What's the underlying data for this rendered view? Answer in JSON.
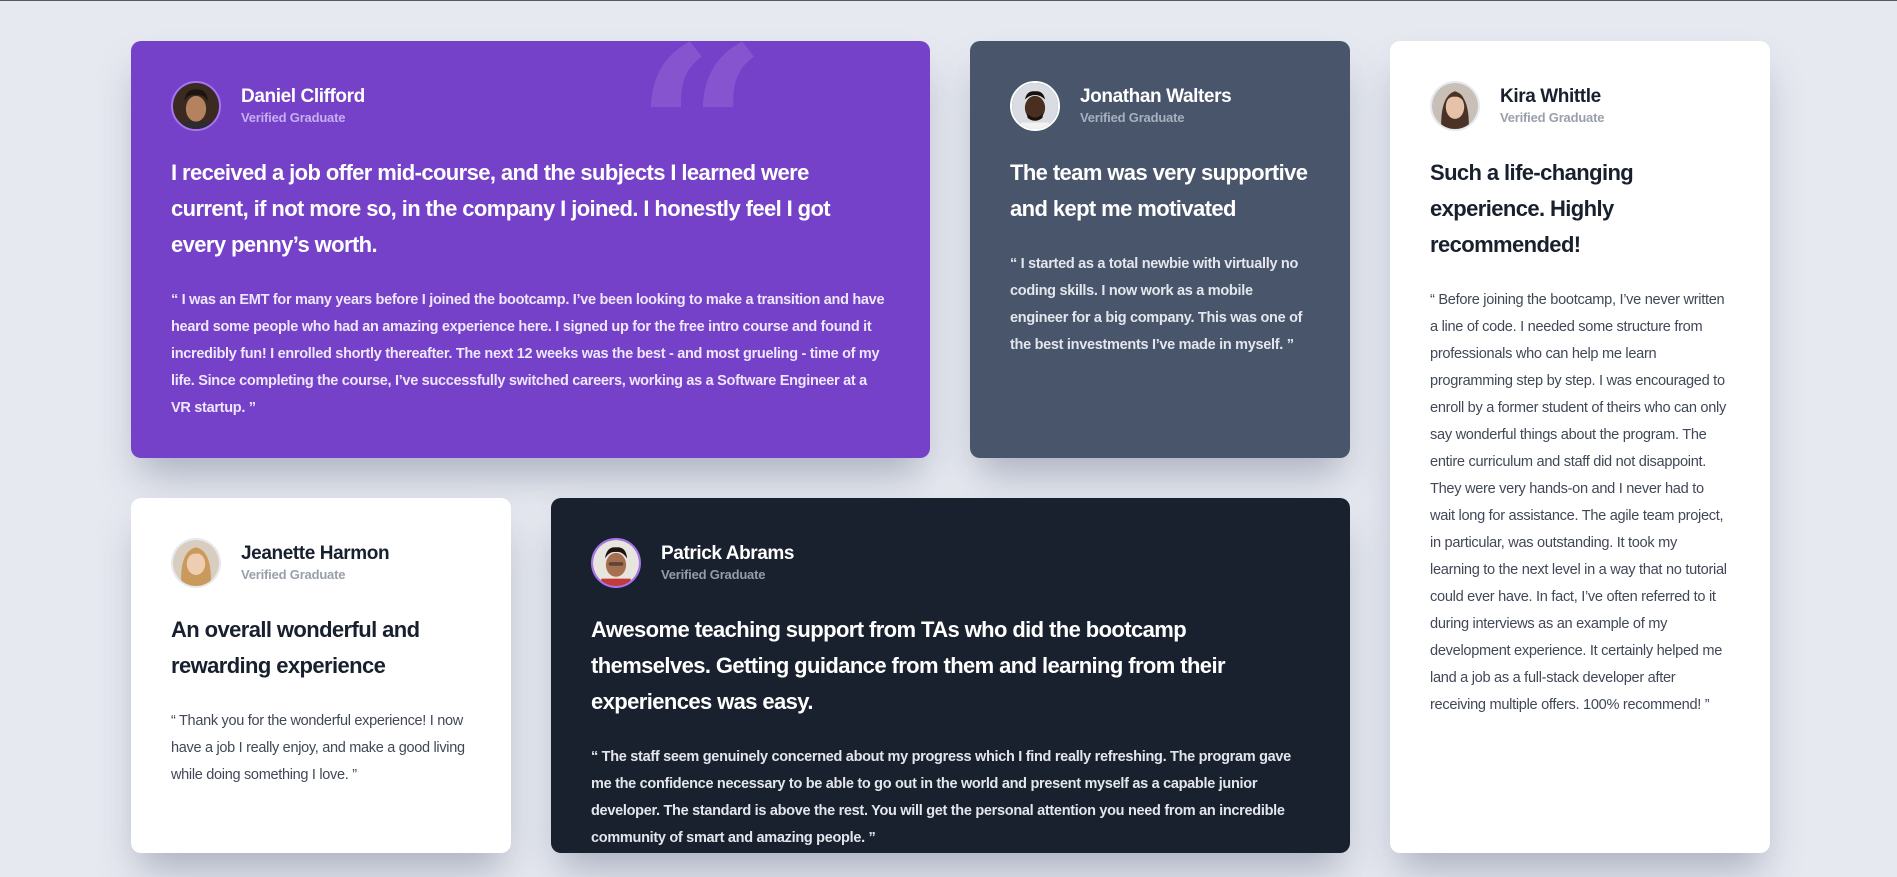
{
  "testimonials": [
    {
      "name": "Daniel Clifford",
      "role": "Verified Graduate",
      "headline": "I received a job offer mid-course, and the subjects I learned were current, if not more so, in the company I joined. I honestly feel I got every penny’s worth.",
      "body": "“ I was an EMT for many years before I joined the bootcamp. I’ve been looking to make a transition and have heard some people who had an amazing experience here. I signed up for the free intro course and found it incredibly fun! I enrolled shortly thereafter. The next 12 weeks was the best - and most grueling - time of my life. Since completing the course, I’ve successfully switched careers, working as a Software Engineer at a VR startup. ”",
      "theme": "#7541c8"
    },
    {
      "name": "Jonathan Walters",
      "role": "Verified Graduate",
      "headline": "The team was very supportive and kept me motivated",
      "body": "“ I started as a total newbie with virtually no coding skills. I now work as a mobile engineer for a big company. This was one of the best investments I’ve made in myself. ”",
      "theme": "#48556a"
    },
    {
      "name": "Kira Whittle",
      "role": "Verified Graduate",
      "headline": "Such a life-changing experience. Highly recommended!",
      "body": "“ Before joining the bootcamp, I’ve never written a line of code. I needed some structure from professionals who can help me learn programming step by step. I was encouraged to enroll by a former student of theirs who can only say wonderful things about the program. The entire curriculum and staff did not disappoint. They were very hands-on and I never had to wait long for assistance. The agile team project, in particular, was outstanding. It took my learning to the next level in a way that no tutorial could ever have. In fact, I’ve often referred to it during interviews as an example of my development experience. It certainly helped me land a job as a full-stack developer after receiving multiple offers. 100% recommend! ”",
      "theme": "#ffffff"
    },
    {
      "name": "Jeanette Harmon",
      "role": "Verified Graduate",
      "headline": "An overall wonderful and rewarding experience",
      "body": "“ Thank you for the wonderful experience! I now have a job I really enjoy, and make a good living while doing something I love. ”",
      "theme": "#ffffff"
    },
    {
      "name": "Patrick Abrams",
      "role": "Verified Graduate",
      "headline": "Awesome teaching support from TAs who did the bootcamp themselves. Getting guidance from them and learning from their experiences was easy.",
      "body": "“ The staff seem genuinely concerned about my progress which I find really refreshing. The program gave me the confidence necessary to be able to go out in the world and present myself as a capable junior developer. The standard is above the rest. You will get the personal attention you need from an incredible community of smart and amazing people. ”",
      "theme": "#19212e"
    }
  ],
  "decoration": {
    "quote_glyph": "“",
    "quote_icon": "quotation-mark-icon"
  },
  "colors": {
    "page_background": "#e6e9f0",
    "purple": "#7541c8",
    "slate": "#48556a",
    "dark": "#19212e",
    "white": "#ffffff"
  }
}
